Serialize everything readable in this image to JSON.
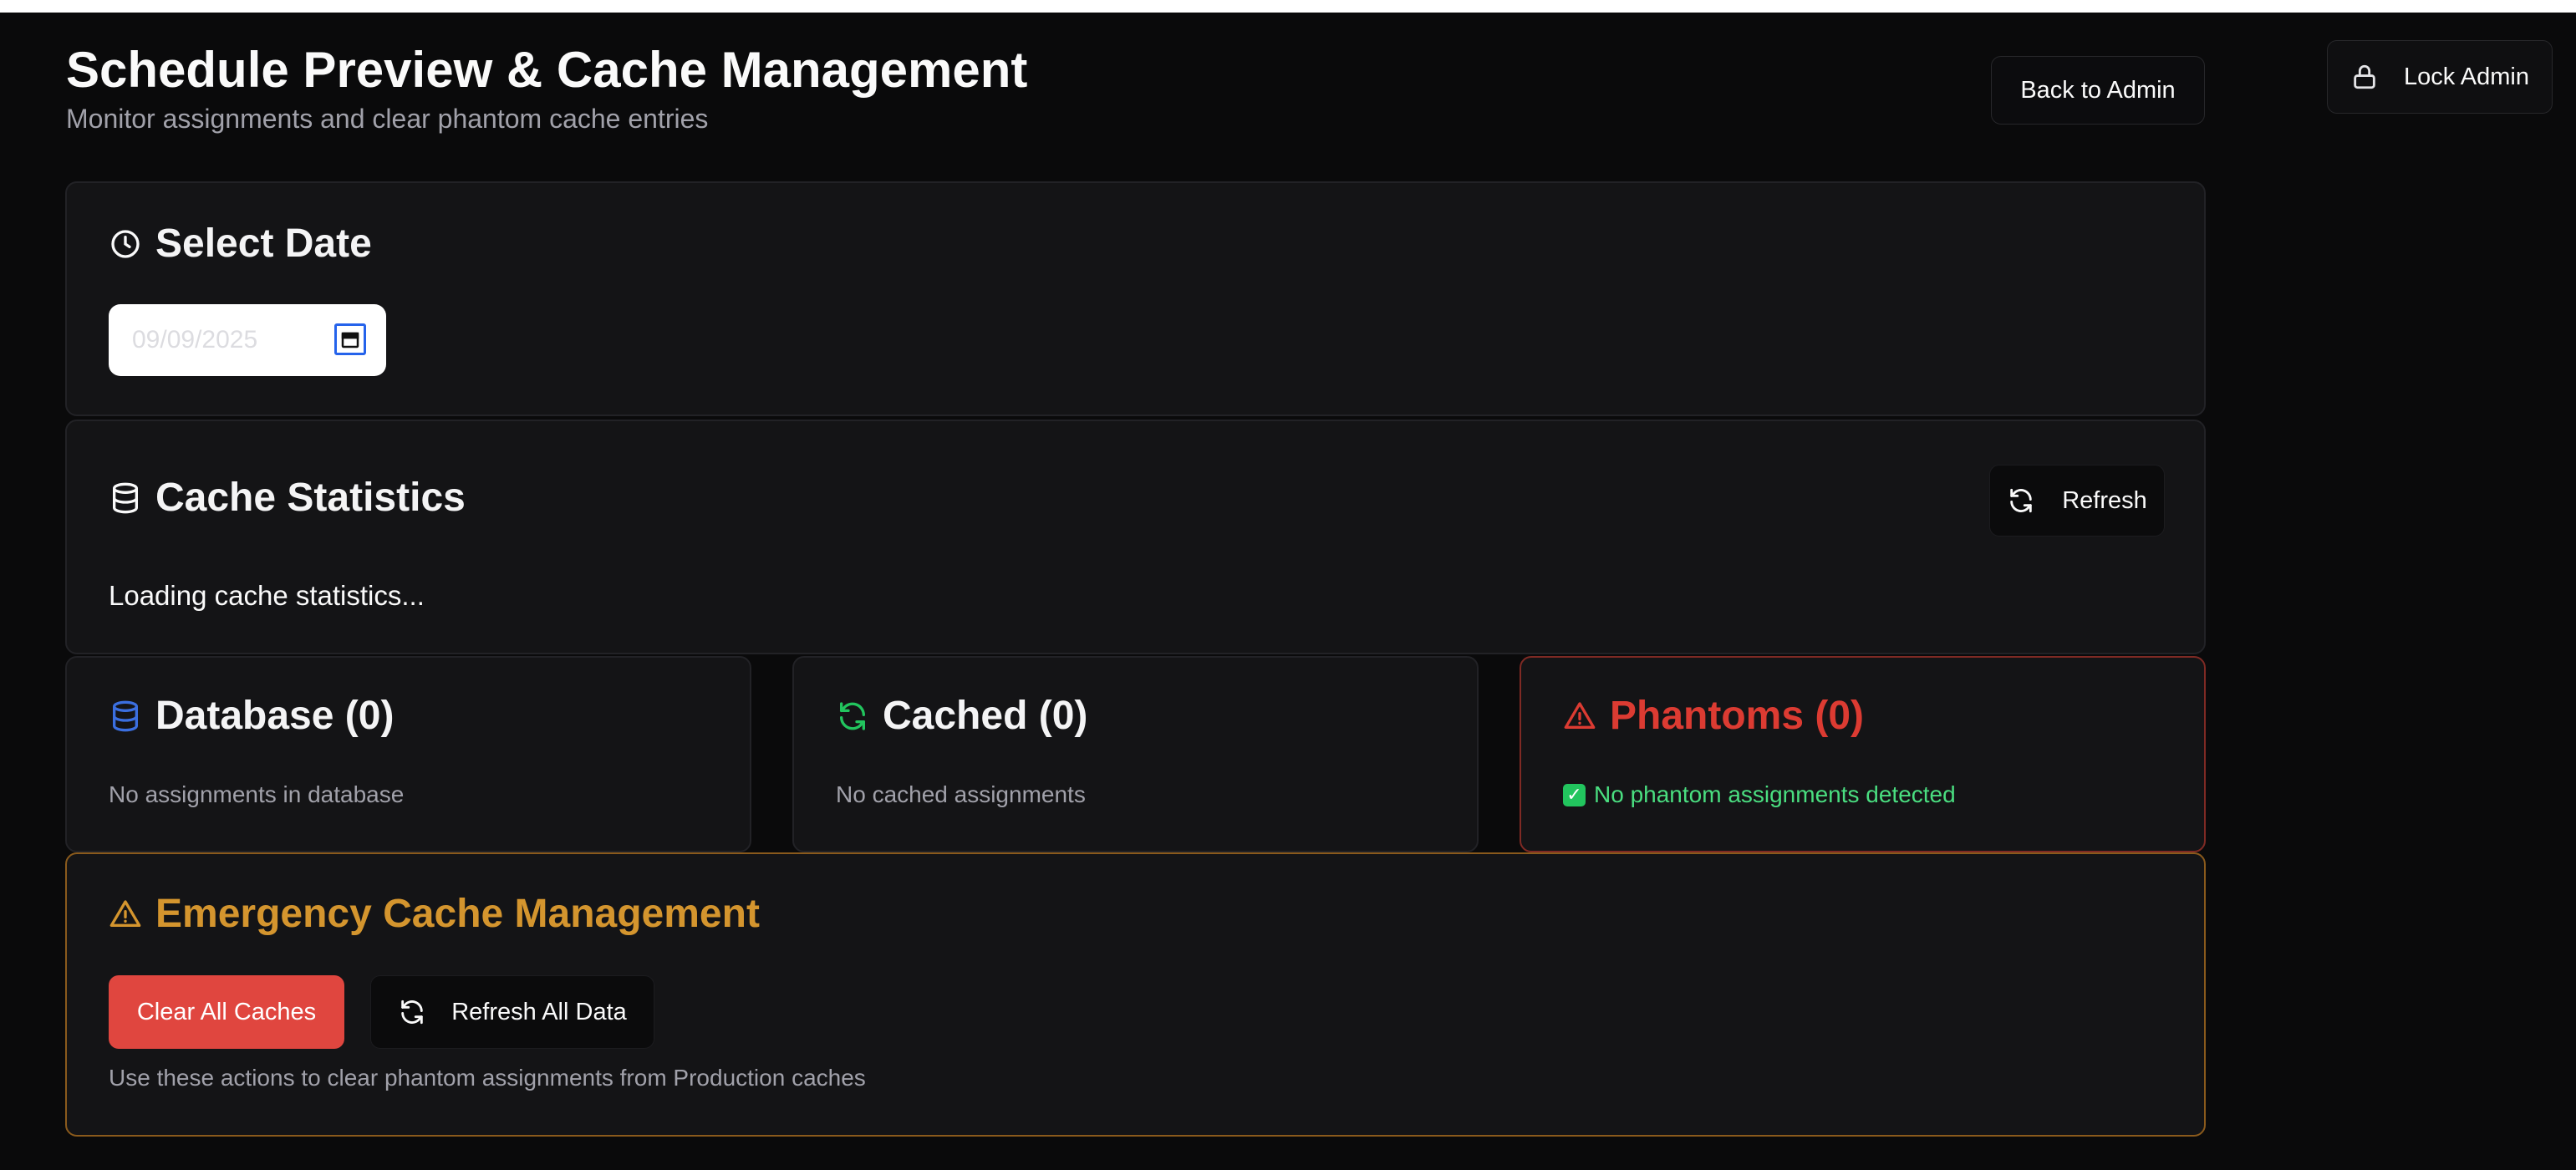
{
  "header": {
    "title": "Schedule Preview & Cache Management",
    "subtitle": "Monitor assignments and clear phantom cache entries",
    "back_label": "Back to Admin",
    "lock_label": "Lock Admin"
  },
  "select_date": {
    "title": "Select Date",
    "date_placeholder": "09/09/2025"
  },
  "cache_stats": {
    "title": "Cache Statistics",
    "refresh_label": "Refresh",
    "loading_text": "Loading cache statistics..."
  },
  "database": {
    "title": "Database (0)",
    "message": "No assignments in database"
  },
  "cached": {
    "title": "Cached (0)",
    "message": "No cached assignments"
  },
  "phantoms": {
    "title": "Phantoms (0)",
    "message": "No phantom assignments detected"
  },
  "emergency": {
    "title": "Emergency Cache Management",
    "clear_label": "Clear All Caches",
    "refresh_all_label": "Refresh All Data",
    "note": "Use these actions to clear phantom assignments from Production caches"
  },
  "colors": {
    "background": "#0a0a0b",
    "card": "#141416",
    "danger": "#e0463f",
    "phantom_red": "#dc3b32",
    "warning_amber": "#d4952e",
    "success_green": "#4ade80",
    "db_blue": "#3b6fe0",
    "cache_green": "#22c55e"
  },
  "icons": {
    "lock": "lock-icon",
    "clock": "clock-icon",
    "database": "database-icon",
    "refresh": "refresh-icon",
    "warning": "warning-icon",
    "calendar": "calendar-icon",
    "check": "check-icon"
  }
}
